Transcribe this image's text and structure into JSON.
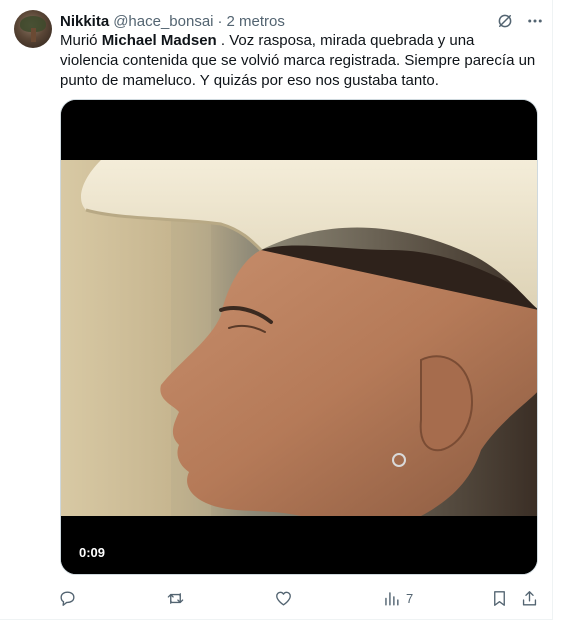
{
  "tweet": {
    "author_name": "Nikkita",
    "handle": "@hace_bonsai",
    "separator": "·",
    "time": "2 metros",
    "text_before": "Murió ",
    "text_bold": "Michael Madsen",
    "text_after": " . Voz rasposa, mirada quebrada y una violencia contenida que se volvió marca registrada. Siempre parecía un punto de mameluco. Y quizás por eso nos gustaba tanto."
  },
  "video": {
    "timestamp": "0:09"
  },
  "actions": {
    "reply_count": "",
    "retweet_count": "",
    "like_count": "",
    "views_count": "7"
  },
  "icons": {
    "header": [
      "grok-icon",
      "more-icon"
    ],
    "actions": [
      "reply-icon",
      "retweet-icon",
      "like-icon",
      "views-icon",
      "bookmark-icon",
      "share-icon"
    ]
  },
  "colors": {
    "text_primary": "#0f1419",
    "text_secondary": "#536471",
    "border": "#eff3f4"
  }
}
